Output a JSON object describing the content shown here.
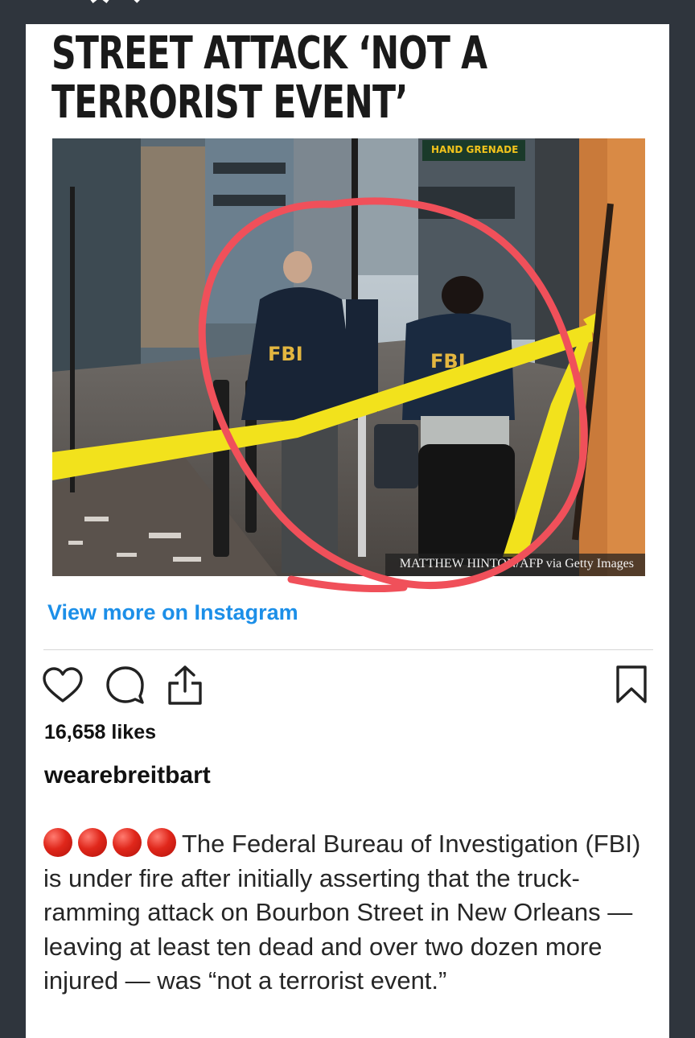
{
  "article": {
    "headline_line1": "STREET ATTACK ‘NOT A",
    "headline_line2": "TERRORIST EVENT’",
    "photo_credit": "MATTHEW HINTON/AFP via Getty Images",
    "storefront_sign": "HAND GRENADE",
    "vest_text_left": "FBI",
    "vest_text_right": "FBI"
  },
  "post": {
    "view_more_label": "View more on Instagram",
    "likes": "16,658 likes",
    "username": "wearebreitbart",
    "caption": "The Federal Bureau of Investigation (FBI) is under fire after initially asserting that the truck-ramming attack on Bourbon Street in New Orleans — leaving at least ten dead and over two dozen more injured — was “not a terrorist event.”",
    "caption_emoji_count": 4
  },
  "icons": {
    "like": "heart-icon",
    "comment": "comment-icon",
    "share": "share-icon",
    "save": "bookmark-icon"
  },
  "colors": {
    "background": "#2f353d",
    "card": "#ffffff",
    "link": "#1c8fe8",
    "annotation_circle": "#f0505a",
    "caution_tape": "#f2e21c",
    "emoji_red": "#e0271b"
  }
}
